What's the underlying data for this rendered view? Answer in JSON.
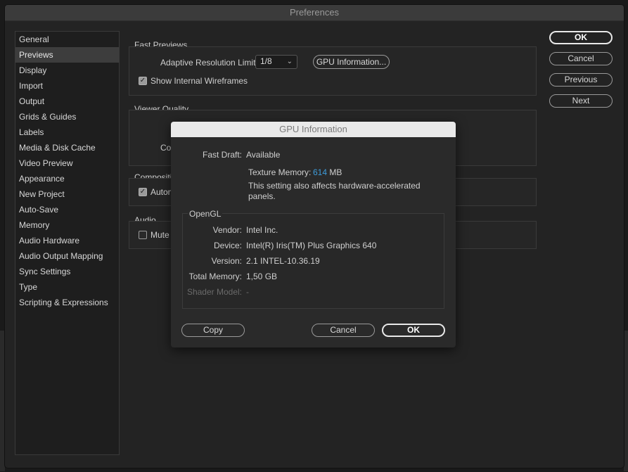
{
  "window": {
    "title": "Preferences"
  },
  "sidebar": {
    "items": [
      {
        "label": "General"
      },
      {
        "label": "Previews",
        "selected": true
      },
      {
        "label": "Display"
      },
      {
        "label": "Import"
      },
      {
        "label": "Output"
      },
      {
        "label": "Grids & Guides"
      },
      {
        "label": "Labels"
      },
      {
        "label": "Media & Disk Cache"
      },
      {
        "label": "Video Preview"
      },
      {
        "label": "Appearance"
      },
      {
        "label": "New Project"
      },
      {
        "label": "Auto-Save"
      },
      {
        "label": "Memory"
      },
      {
        "label": "Audio Hardware"
      },
      {
        "label": "Audio Output Mapping"
      },
      {
        "label": "Sync Settings"
      },
      {
        "label": "Type"
      },
      {
        "label": "Scripting & Expressions"
      }
    ]
  },
  "fast_previews": {
    "title": "Fast Previews",
    "adaptive_label": "Adaptive Resolution Limit:",
    "adaptive_value": "1/8",
    "gpu_button": "GPU Information...",
    "wireframes_label": "Show Internal Wireframes",
    "wireframes_checked": true
  },
  "viewer_quality": {
    "title": "Viewer Quality",
    "partial_label": "Col"
  },
  "composition": {
    "title": "Compositi",
    "partial_label": "Autom",
    "checked": true
  },
  "audio": {
    "title": "Audio",
    "partial_label": "Mute ",
    "checked": false
  },
  "dialog_buttons": {
    "ok": "OK",
    "cancel": "Cancel",
    "previous": "Previous",
    "next": "Next"
  },
  "gpu_modal": {
    "title": "GPU Information",
    "fast_draft_label": "Fast Draft:",
    "fast_draft_value": "Available",
    "texture_memory_label": "Texture Memory:",
    "texture_memory_value": "614",
    "texture_memory_unit": "MB",
    "note_line1": "This setting also affects hardware-accelerated",
    "note_line2": "panels.",
    "opengl_title": "OpenGL",
    "vendor_label": "Vendor:",
    "vendor_value": "Intel Inc.",
    "device_label": "Device:",
    "device_value": "Intel(R) Iris(TM) Plus Graphics 640",
    "version_label": "Version:",
    "version_value": "2.1 INTEL-10.36.19",
    "total_memory_label": "Total Memory:",
    "total_memory_value": "1,50 GB",
    "shader_model_label": "Shader Model:",
    "shader_model_value": "-",
    "copy_button": "Copy",
    "cancel_button": "Cancel",
    "ok_button": "OK"
  },
  "colors": {
    "accent": "#3e9bd9"
  }
}
